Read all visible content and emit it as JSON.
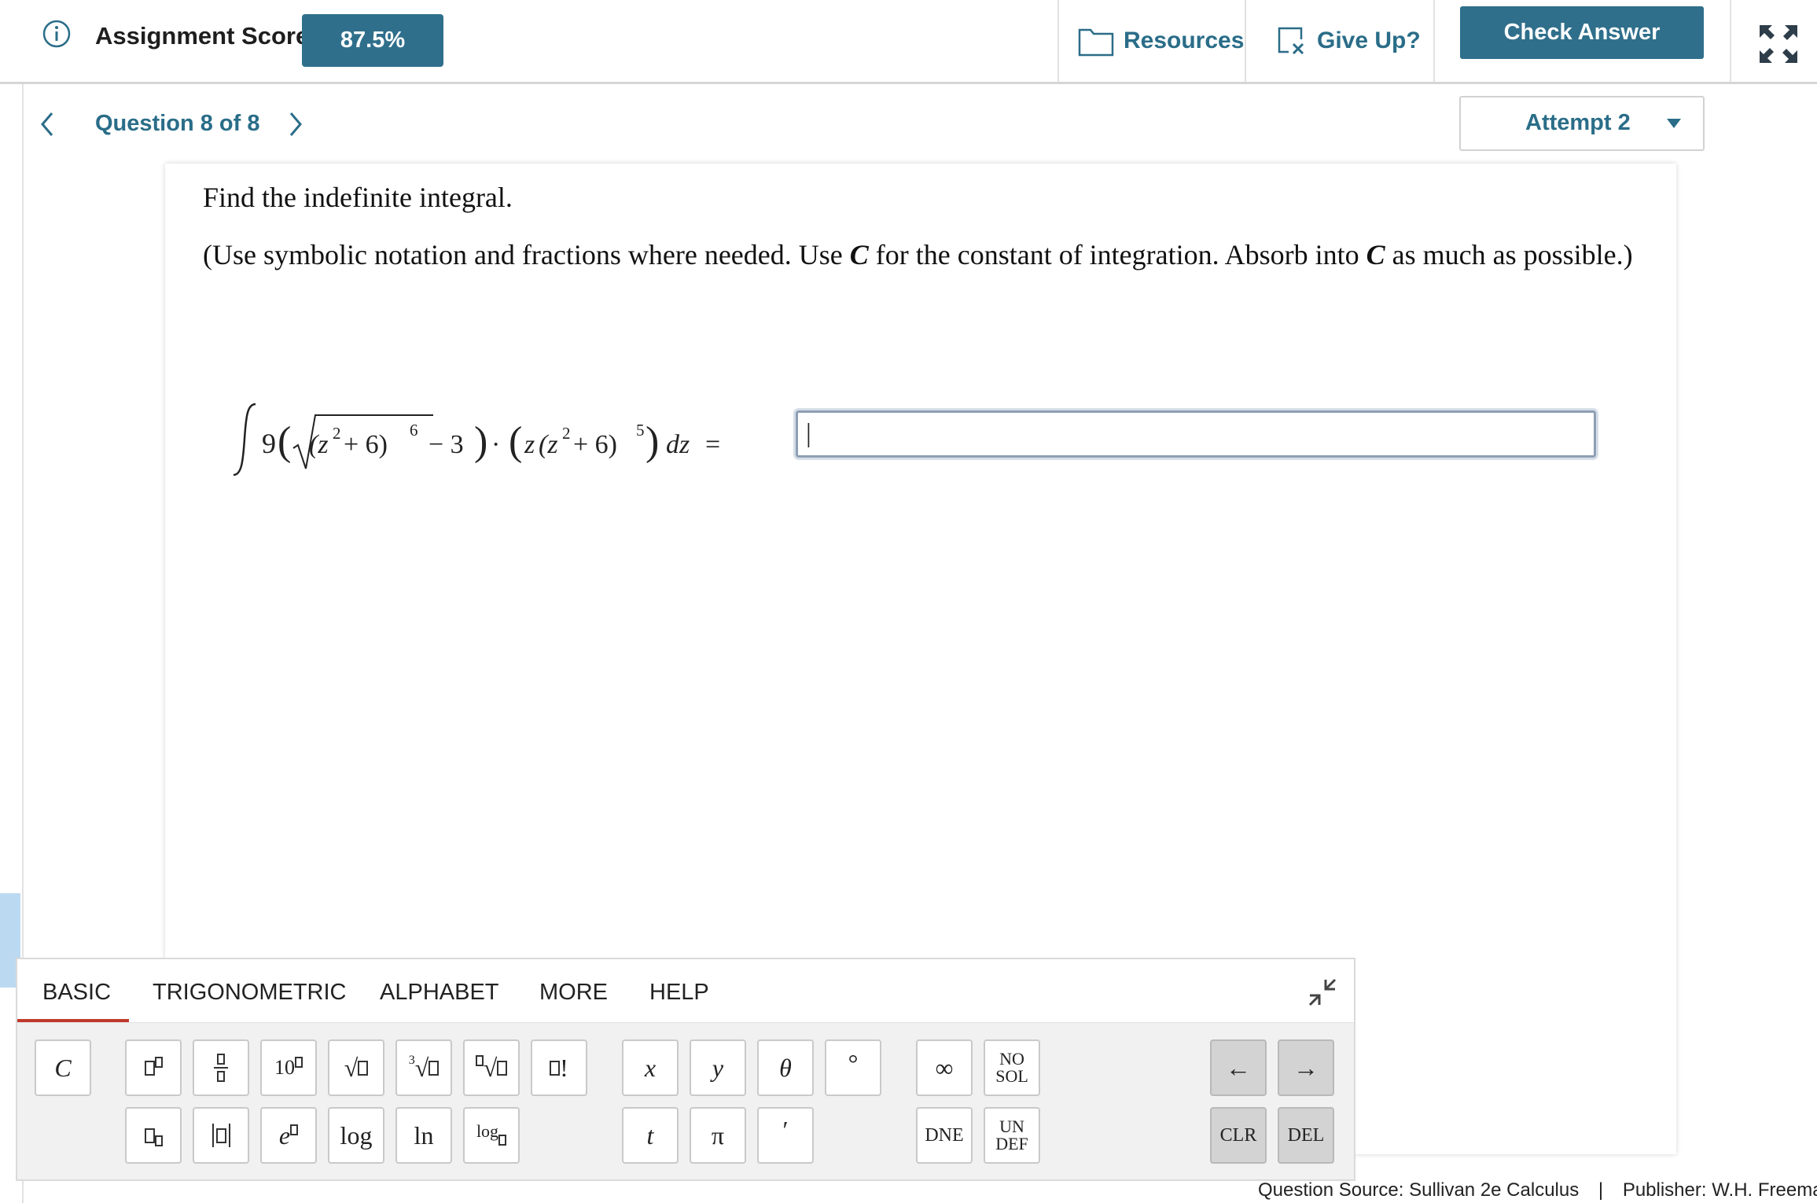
{
  "header": {
    "score_label": "Assignment Score:",
    "score_value": "87.5%",
    "resources_label": "Resources",
    "give_up_label": "Give Up?",
    "check_answer_label": "Check Answer"
  },
  "nav": {
    "question_label": "Question 8 of 8",
    "attempt_label": "Attempt 2"
  },
  "question": {
    "instruction": "Find the indefinite integral.",
    "note_part1": "(Use symbolic notation and fractions where needed. Use ",
    "note_var1": "C",
    "note_part2": " for the constant of integration. Absorb into ",
    "note_var2": "C",
    "note_part3": " as much as possible.)",
    "math": {
      "coef": "9",
      "z2_6": "(z",
      "exp2": "2",
      "plus6": " + 6)",
      "exp6": "6",
      "minus3": " − 3",
      "dot": "·",
      "z": "z",
      "exp5": "5",
      "dz": "dz",
      "eq": "="
    },
    "answer_value": "|"
  },
  "keyboard": {
    "tabs": [
      "BASIC",
      "TRIGONOMETRIC",
      "ALPHABET",
      "MORE",
      "HELP"
    ],
    "active_tab": "BASIC",
    "keys": {
      "c": "C",
      "ten": "10",
      "e": "e",
      "log": "log",
      "ln": "ln",
      "logb": "log",
      "x": "x",
      "y": "y",
      "theta": "θ",
      "degree": "°",
      "t": "t",
      "pi": "π",
      "prime": "′",
      "infinity": "∞",
      "no_sol": "NO SOL",
      "dne": "DNE",
      "undef": "UN DEF",
      "left": "←",
      "right": "→",
      "clr": "CLR",
      "del": "DEL",
      "cube_root_index": "3",
      "factorial": "!"
    }
  },
  "footer": {
    "source": "Question Source: Sullivan 2e Calculus",
    "sep": "|",
    "publisher": "Publisher: W.H. Freeman"
  }
}
